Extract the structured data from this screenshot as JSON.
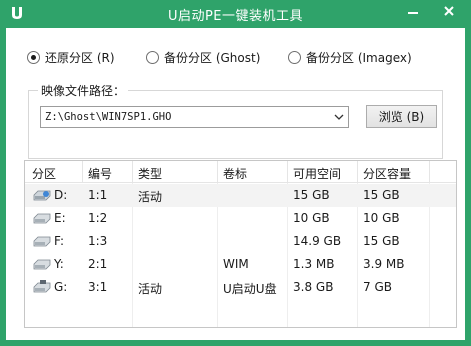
{
  "window": {
    "title": "U启动PE一键装机工具",
    "accent": "#2fa36a",
    "app_icon": "u-logo-icon",
    "controls": [
      "minimize-icon",
      "close-icon"
    ]
  },
  "modes": [
    {
      "label": "还原分区 (R)",
      "checked": true
    },
    {
      "label": "备份分区 (Ghost)",
      "checked": false
    },
    {
      "label": "备份分区 (Imagex)",
      "checked": false
    }
  ],
  "image_path": {
    "label": "映像文件路径：",
    "value": "Z:\\Ghost\\WIN7SP1.GHO",
    "browse_label": "浏览 (B)"
  },
  "table": {
    "columns": [
      "分区",
      "编号",
      "类型",
      "卷标",
      "可用空间",
      "分区容量"
    ],
    "rows": [
      {
        "drive": "D:",
        "number": "1:1",
        "type": "活动",
        "label": "",
        "free": "15 GB",
        "size": "15 GB",
        "selected": true,
        "icon": "drive-system-icon"
      },
      {
        "drive": "E:",
        "number": "1:2",
        "type": "",
        "label": "",
        "free": "10 GB",
        "size": "10 GB",
        "selected": false,
        "icon": "drive-icon"
      },
      {
        "drive": "F:",
        "number": "1:3",
        "type": "",
        "label": "",
        "free": "14.9 GB",
        "size": "15 GB",
        "selected": false,
        "icon": "drive-icon"
      },
      {
        "drive": "Y:",
        "number": "2:1",
        "type": "",
        "label": "WIM",
        "free": "1.3 MB",
        "size": "3.9 MB",
        "selected": false,
        "icon": "drive-icon"
      },
      {
        "drive": "G:",
        "number": "3:1",
        "type": "活动",
        "label": "U启动U盘",
        "free": "3.8 GB",
        "size": "7 GB",
        "selected": false,
        "icon": "usb-drive-icon"
      }
    ]
  }
}
